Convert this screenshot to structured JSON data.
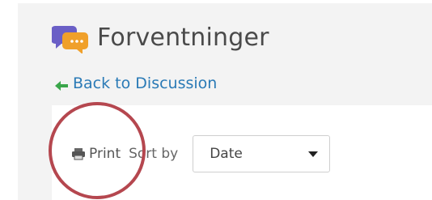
{
  "header": {
    "title": "Forventninger",
    "icon": "discussion-bubbles-icon",
    "icon_colors": {
      "back": "#6a5fc6",
      "front": "#f0a02a"
    }
  },
  "nav": {
    "back_label": "Back to Discussion",
    "back_icon": "arrow-left-icon",
    "back_color": "#2a7ab6",
    "arrow_color": "#3aa64a"
  },
  "toolbar": {
    "print_label": "Print",
    "print_icon": "printer-icon",
    "sort_label": "Sort by",
    "sort_select": {
      "value": "Date"
    }
  },
  "annotation": {
    "highlight": "circle-around-print",
    "color": "#b5474f"
  }
}
